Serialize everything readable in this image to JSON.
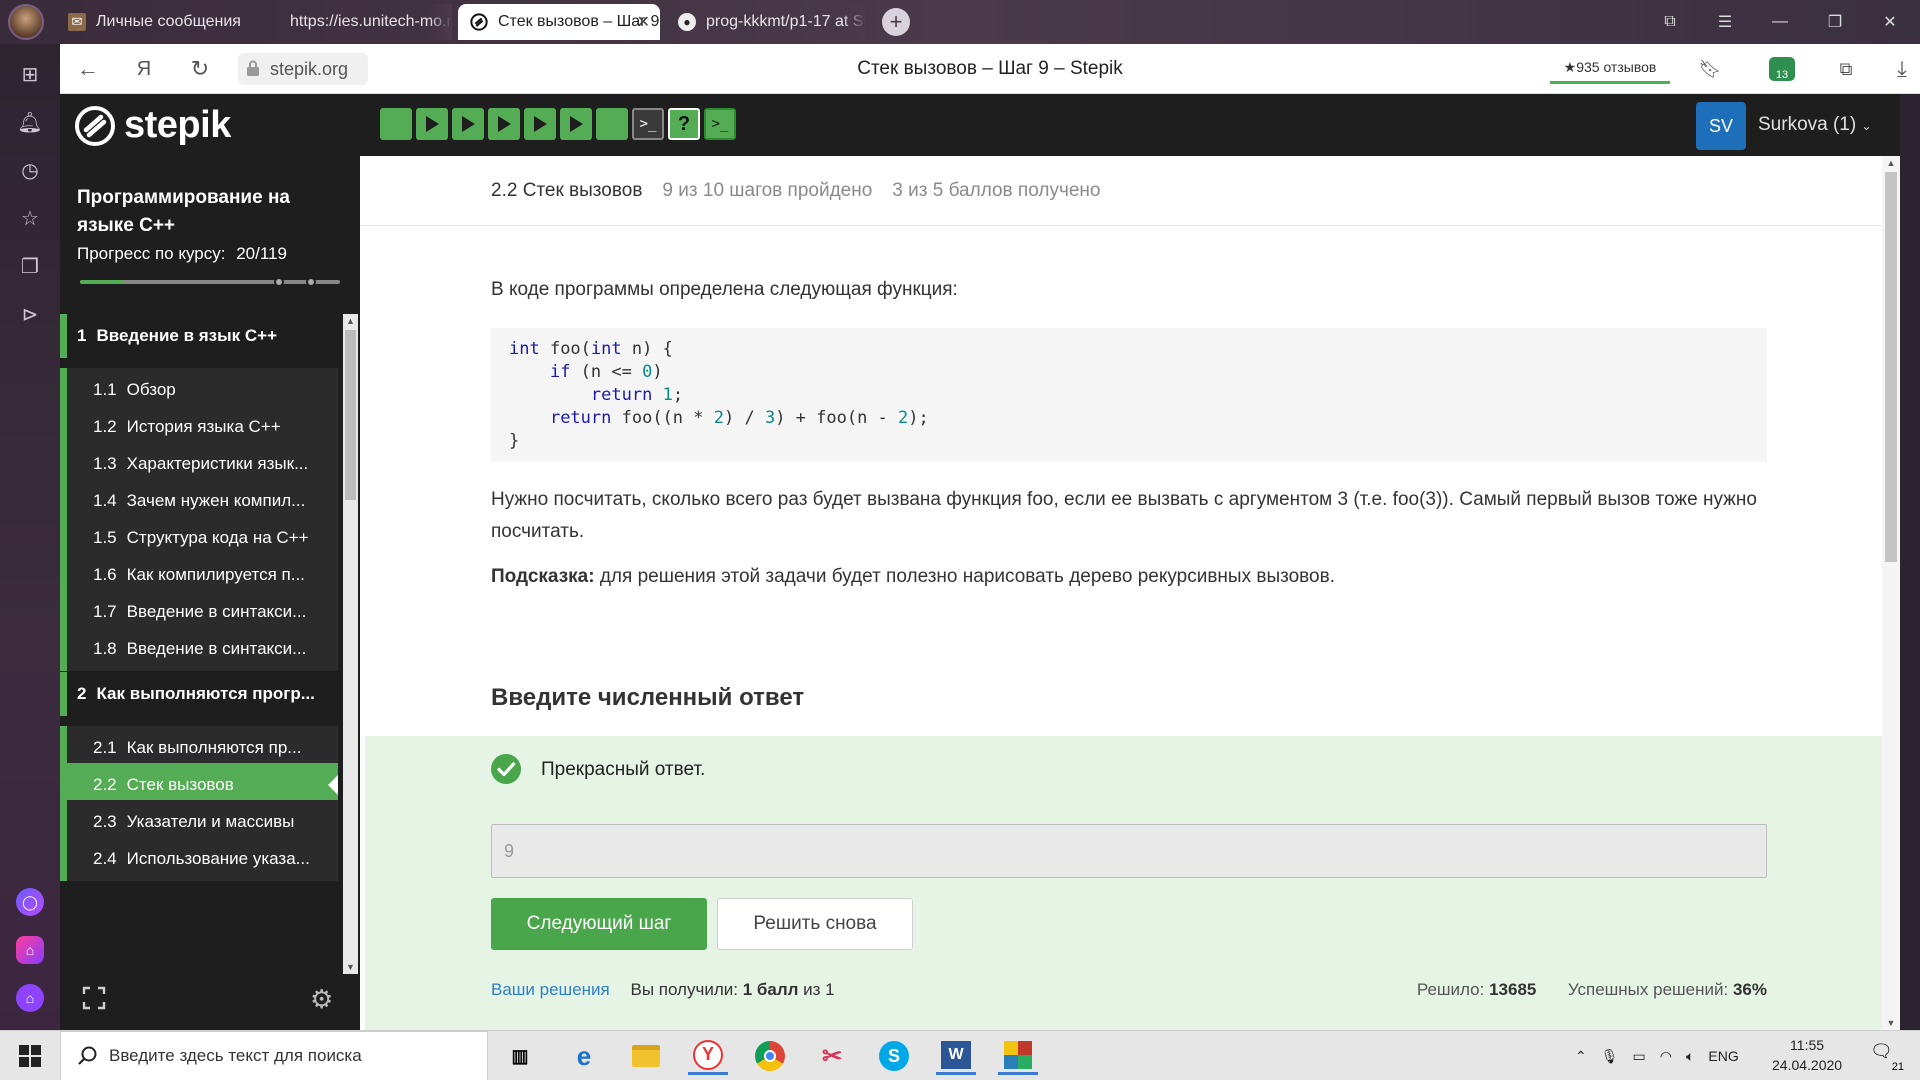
{
  "browser": {
    "tabs": [
      {
        "title": "Личные сообщения",
        "icon": "mail-icon"
      },
      {
        "title": "https://ies.unitech-mo.ru/fi",
        "icon": "page-icon"
      },
      {
        "title": "Стек вызовов – Шаг 9 -",
        "icon": "stepik-icon",
        "active": true
      },
      {
        "title": "prog-kkkmt/p1-17 at Surko",
        "icon": "github-icon"
      }
    ],
    "url": "stepik.org",
    "page_title": "Стек вызовов – Шаг 9 – Stepik",
    "reviews": "★935 отзывов",
    "yandex_button": "Я",
    "badge_count": "13"
  },
  "stepik": {
    "logo_text": "stepik",
    "avatar_initials": "SV",
    "username": "Surkova (1)",
    "step_strip": [
      "solid",
      "play",
      "play",
      "play",
      "play",
      "play",
      "solid",
      "terminal",
      "quiz",
      "terminal"
    ],
    "quiz_mark": "?",
    "terminal_mark": ">_"
  },
  "sidebar": {
    "course_title": "Программирование на языке C++",
    "progress_label": "Прогресс по курсу:",
    "progress_value": "20/119",
    "progress_fraction": 0.168,
    "items": [
      {
        "type": "module",
        "num": "1",
        "label": "Введение в язык C++"
      },
      {
        "type": "lesson",
        "num": "1.1",
        "label": "Обзор"
      },
      {
        "type": "lesson",
        "num": "1.2",
        "label": "История языка C++"
      },
      {
        "type": "lesson",
        "num": "1.3",
        "label": "Характеристики язык..."
      },
      {
        "type": "lesson",
        "num": "1.4",
        "label": "Зачем нужен компил..."
      },
      {
        "type": "lesson",
        "num": "1.5",
        "label": "Структура кода на C++"
      },
      {
        "type": "lesson",
        "num": "1.6",
        "label": "Как компилируется п..."
      },
      {
        "type": "lesson",
        "num": "1.7",
        "label": "Введение в синтакси..."
      },
      {
        "type": "lesson",
        "num": "1.8",
        "label": "Введение в синтакси..."
      },
      {
        "type": "module",
        "num": "2",
        "label": "Как выполняются прогр..."
      },
      {
        "type": "lesson",
        "num": "2.1",
        "label": "Как выполняются пр..."
      },
      {
        "type": "lesson",
        "num": "2.2",
        "label": "Стек вызовов",
        "active": true
      },
      {
        "type": "lesson",
        "num": "2.3",
        "label": "Указатели и массивы"
      },
      {
        "type": "lesson",
        "num": "2.4",
        "label": "Использование указа..."
      }
    ]
  },
  "lesson": {
    "title": "2.2 Стек вызовов",
    "steps_passed": "9 из 10 шагов пройдено",
    "points": "3 из 5 баллов  получено",
    "intro": "В коде программы определена следующая функция:",
    "code_lines": [
      "int foo(int n) {",
      "    if (n <= 0)",
      "        return 1;",
      "    return foo((n * 2) / 3) + foo(n - 2);",
      "}"
    ],
    "question": "Нужно посчитать, сколько всего раз будет вызвана функция foo, если ее вызвать с аргументом 3 (т.е. foo(3)). Самый первый вызов тоже нужно посчитать.",
    "hint_label": "Подсказка:",
    "hint_text": " для решения этой задачи будет полезно нарисовать дерево рекурсивных вызовов.",
    "answer_heading": "Введите численный ответ",
    "feedback": "Прекрасный ответ.",
    "answer_value": "9",
    "next_button": "Следующий шаг",
    "retry_button": "Решить снова",
    "your_solutions": "Ваши решения",
    "you_got_prefix": "Вы получили:",
    "you_got_value": "1 балл",
    "you_got_suffix": "из 1",
    "solved_label": "Решило:",
    "solved_value": "13685",
    "success_label": "Успешных решений:",
    "success_value": "36%"
  },
  "taskbar": {
    "search_placeholder": "Введите здесь текст для поиска",
    "lang": "ENG",
    "time": "11:55",
    "date": "24.04.2020",
    "notif_count": "21"
  },
  "colors": {
    "accent_green": "#54ad54",
    "stepik_dark": "#1e1e1e",
    "link_blue": "#2e7fc8"
  }
}
